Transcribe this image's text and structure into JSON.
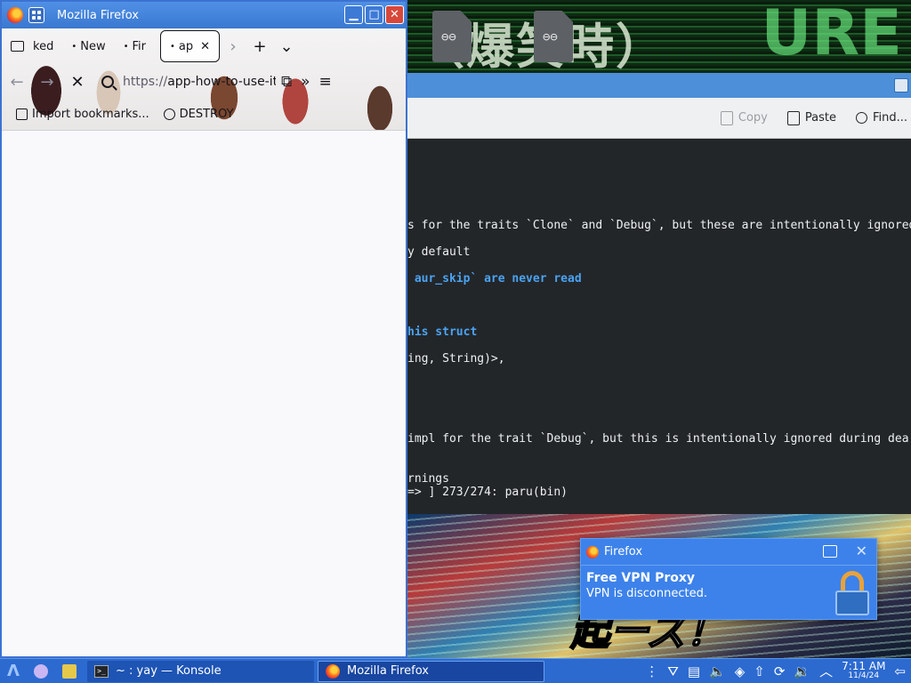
{
  "firefox": {
    "window_title": "Mozilla Firefox",
    "tabs": [
      {
        "label": "ked"
      },
      {
        "label": "New"
      },
      {
        "label": "Fir"
      },
      {
        "label": "ap"
      }
    ],
    "url_proto": "https://",
    "url_host": "app-how-to-use-it",
    "bookmarks": [
      {
        "label": "Import bookmarks..."
      },
      {
        "label": "DESTROY"
      }
    ]
  },
  "konsole": {
    "toolbar": {
      "copy": "Copy",
      "paste": "Paste",
      "find": "Find..."
    },
    "lines": [
      {
        "text": "s for the traits `Clone` and `Debug`, but these are intentionally ignored",
        "bold": false
      },
      {
        "text": "y default",
        "bold": false
      },
      {
        "text": " aur_skip` are never read",
        "bold": true
      },
      {
        "text": "his struct",
        "bold": true
      },
      {
        "text": "ing, String)>,",
        "bold": false
      },
      {
        "text": "impl for the trait `Debug`, but this is intentionally ignored during dea",
        "bold": false
      },
      {
        "text": "rnings",
        "bold": false
      },
      {
        "text": "=> ] 273/274: paru(bin)",
        "bold": false
      }
    ]
  },
  "notification": {
    "app": "Firefox",
    "title": "Free VPN Proxy",
    "body": "VPN is disconnected."
  },
  "taskbar": {
    "tasks": [
      {
        "label": "~ : yay — Konsole"
      },
      {
        "label": "Mozilla Firefox"
      }
    ],
    "time": "7:11 AM",
    "date": "11/4/24"
  }
}
